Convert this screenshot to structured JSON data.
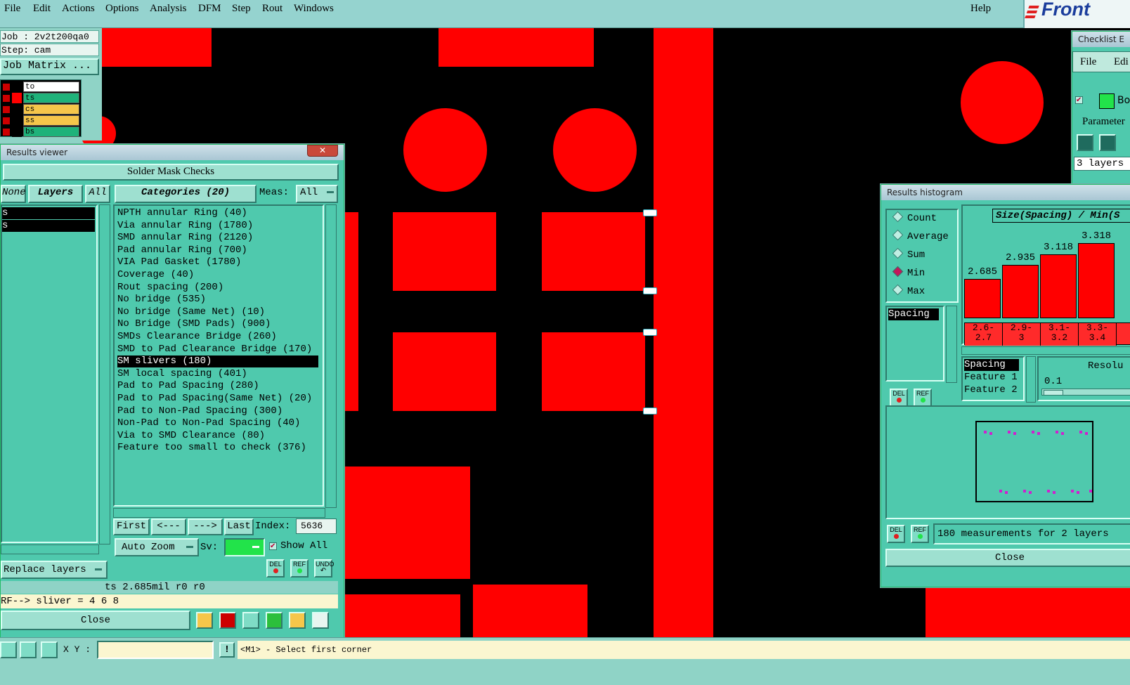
{
  "menu": [
    "File",
    "Edit",
    "Actions",
    "Options",
    "Analysis",
    "DFM",
    "Step",
    "Rout",
    "Windows"
  ],
  "help_label": "Help",
  "logo_text": "Front",
  "job": {
    "job_line": "Job : 2v2t200qa0",
    "step_line": "Step: cam",
    "matrix_label": "Job Matrix ..."
  },
  "layers": [
    {
      "name": "to",
      "color": "#ffffff",
      "swatch": "#000000"
    },
    {
      "name": "ts",
      "color": "#1fb27a",
      "swatch": "#ff0000"
    },
    {
      "name": "cs",
      "color": "#f6c64a",
      "swatch": "#000000"
    },
    {
      "name": "ss",
      "color": "#f6c64a",
      "swatch": "#000000"
    },
    {
      "name": "bs",
      "color": "#1fb27a",
      "swatch": "#000000"
    }
  ],
  "results_viewer": {
    "title": "Results viewer",
    "header": "Solder Mask Checks",
    "none_label": "None",
    "layers_label": "Layers",
    "all_label": "All",
    "categories_label": "Categories (20)",
    "meas_label": "Meas:",
    "meas_value": "All",
    "left_list": [
      "s",
      "s"
    ],
    "categories": [
      "NPTH annular Ring (40)",
      "Via annular Ring (1780)",
      "SMD annular Ring (2120)",
      "Pad annular Ring (700)",
      "VIA Pad Gasket (1780)",
      "Coverage (40)",
      "Rout spacing (200)",
      "No bridge (535)",
      "No bridge (Same Net) (10)",
      "No Bridge (SMD Pads) (900)",
      "SMDs Clearance Bridge (260)",
      "SMD to Pad Clearance Bridge (170)",
      "SM slivers (180)",
      "SM local spacing (401)",
      "Pad to Pad Spacing (280)",
      "Pad to Pad Spacing(Same Net) (20)",
      "Pad to Non-Pad Spacing (300)",
      "Non-Pad to Non-Pad Spacing (40)",
      "Via to SMD Clearance (80)",
      "Feature too small to check (376)"
    ],
    "selected_index": 12,
    "nav": {
      "first": "First",
      "prev": "<---",
      "next": "--->",
      "last": "Last",
      "index_label": "Index:",
      "index_value": "5636"
    },
    "auto_zoom": "Auto Zoom",
    "sv_label": "Sv:",
    "show_all_label": "Show  All",
    "replace_layers": "Replace layers",
    "del_label": "DEL",
    "ref_label": "REF",
    "undo_label": "UNDO",
    "info_line": "ts 2.685mil  r0  r0",
    "sliver_line": "RF--> sliver = 4 6 8",
    "close_label": "Close"
  },
  "checklist": {
    "title": "Checklist E",
    "file": "File",
    "edit": "Edi",
    "param": "Parameter",
    "layers_text": "3 layers",
    "item": "Bo"
  },
  "histogram": {
    "title": "Results histogram",
    "modes": [
      "Count",
      "Average",
      "Sum",
      "Min",
      "Max"
    ],
    "selected_mode": "Min",
    "spacing_item": "Spacing",
    "chart_title": "Size(Spacing) / Min(S",
    "bars": [
      2.685,
      2.935,
      3.118,
      3.318
    ],
    "bar_labels": [
      "2.685",
      "2.935",
      "3.118",
      "3.318"
    ],
    "bins": [
      "2.6-\n2.7",
      "2.9-\n3",
      "3.1-\n3.2",
      "3.3-\n3.4"
    ],
    "fields": [
      "Spacing",
      "Feature 1",
      "Feature 2"
    ],
    "resolution_label": "Resolu",
    "resolution_value": "0.1",
    "summary": "180 measurements for 2 layers",
    "close_label": "Close",
    "del_label": "DEL",
    "ref_label": "REF"
  },
  "statusbar": {
    "xy_label": "X Y :",
    "excl": "!",
    "message": "<M1> - Select first corner"
  },
  "chart_data": {
    "type": "bar",
    "title": "Size(Spacing) / Min(S",
    "categories": [
      "2.6-2.7",
      "2.9-3",
      "3.1-3.2",
      "3.3-3.4"
    ],
    "values": [
      2.685,
      2.935,
      3.118,
      3.318
    ],
    "xlabel": "",
    "ylabel": ""
  }
}
